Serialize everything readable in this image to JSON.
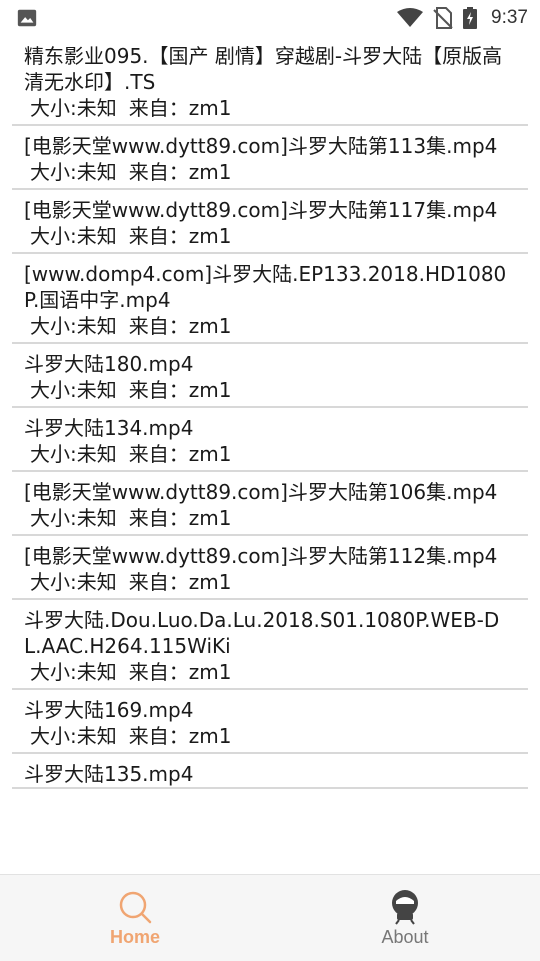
{
  "status_bar": {
    "time": "9:37",
    "icons": [
      "image-icon",
      "wifi-icon",
      "no-sim-icon",
      "battery-charging-icon"
    ]
  },
  "files": [
    {
      "title": "精东影业095.【国产 剧情】穿越剧-斗罗大陆【原版高清无水印】.TS",
      "size": "大小:未知",
      "source": "来自：zm1"
    },
    {
      "title": "[电影天堂www.dytt89.com]斗罗大陆第113集.mp4",
      "size": "大小:未知",
      "source": "来自：zm1"
    },
    {
      "title": "[电影天堂www.dytt89.com]斗罗大陆第117集.mp4",
      "size": "大小:未知",
      "source": "来自：zm1"
    },
    {
      "title": "[www.domp4.com]斗罗大陆.EP133.2018.HD1080P.国语中字.mp4",
      "size": "大小:未知",
      "source": "来自：zm1"
    },
    {
      "title": "斗罗大陆180.mp4",
      "size": "大小:未知",
      "source": "来自：zm1"
    },
    {
      "title": "斗罗大陆134.mp4",
      "size": "大小:未知",
      "source": "来自：zm1"
    },
    {
      "title": "[电影天堂www.dytt89.com]斗罗大陆第106集.mp4",
      "size": "大小:未知",
      "source": "来自：zm1"
    },
    {
      "title": "[电影天堂www.dytt89.com]斗罗大陆第112集.mp4",
      "size": "大小:未知",
      "source": "来自：zm1"
    },
    {
      "title": "斗罗大陆.Dou.Luo.Da.Lu.2018.S01.1080P.WEB-DL.AAC.H264.115WiKi",
      "size": "大小:未知",
      "source": "来自：zm1"
    },
    {
      "title": "斗罗大陆169.mp4",
      "size": "大小:未知",
      "source": "来自：zm1"
    },
    {
      "title": "斗罗大陆135.mp4",
      "size": "",
      "source": ""
    }
  ],
  "bottom_nav": {
    "home_label": "Home",
    "about_label": "About",
    "active_color": "#f0a572",
    "inactive_color": "#777777"
  }
}
